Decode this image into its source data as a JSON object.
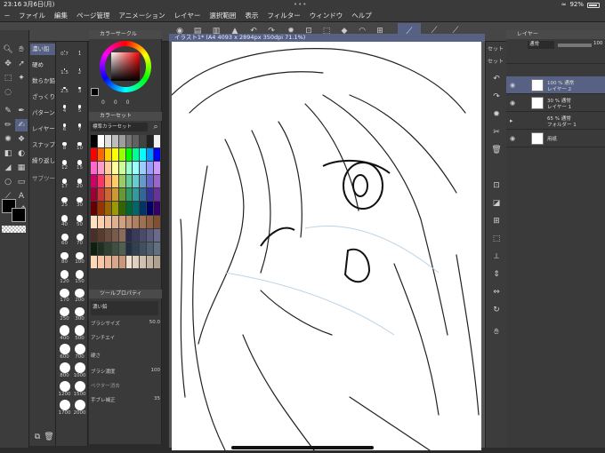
{
  "status": {
    "time": "23:16",
    "date": "3月6日(月)",
    "battery": "92%"
  },
  "menu": {
    "items": [
      "ファイル",
      "編集",
      "ページ管理",
      "アニメーション",
      "レイヤー",
      "選択範囲",
      "表示",
      "フィルター",
      "ウィンドウ",
      "ヘルプ"
    ]
  },
  "document": {
    "tab_title": "イラスト1* (A4 4093 x 2894px 350dpi 71.1%)"
  },
  "subtools": {
    "items": [
      "濃い鉛",
      "硬め",
      "数らか鉛",
      "ざっくり",
      "パターン",
      "レイヤー",
      "スナップ",
      "繰り返し",
      "サブツール"
    ]
  },
  "brush_sizes": [
    "0.7",
    "1",
    "1.5",
    "2",
    "2.5",
    "3",
    "4",
    "5",
    "6",
    "7",
    "8",
    "10",
    "12",
    "15",
    "17",
    "20",
    "25",
    "30",
    "40",
    "50",
    "60",
    "70",
    "80",
    "100",
    "120",
    "150",
    "170",
    "200",
    "250",
    "300",
    "400",
    "500",
    "600",
    "700",
    "800",
    "1000",
    "1200",
    "1500",
    "1700",
    "2000"
  ],
  "color_panel": {
    "title": "カラーサークル",
    "hsv_h": "0",
    "hsv_s": "0",
    "hsv_v": "0"
  },
  "color_set": {
    "title": "カラーセット",
    "set_name": "標準カラーセット",
    "swatches": [
      "#000000",
      "#ffffff",
      "#e0e0e0",
      "#bdbdbd",
      "#9e9e9e",
      "#757575",
      "#616161",
      "#424242",
      "#212121",
      "#f2f2f2",
      "#ff0000",
      "#ff6600",
      "#ffcc00",
      "#ffff00",
      "#99ff00",
      "#00ff00",
      "#00ff99",
      "#00ffff",
      "#0099ff",
      "#0000ff",
      "#ff66cc",
      "#ff99cc",
      "#ffcc99",
      "#ffff99",
      "#ccff99",
      "#99ffcc",
      "#99ffff",
      "#99ccff",
      "#9999ff",
      "#cc99ff",
      "#cc0066",
      "#ff3366",
      "#ff9966",
      "#ffcc66",
      "#99cc66",
      "#66cc99",
      "#66cccc",
      "#6699cc",
      "#6666cc",
      "#9966cc",
      "#990033",
      "#cc3333",
      "#cc6633",
      "#cc9933",
      "#669933",
      "#339966",
      "#339999",
      "#336699",
      "#333399",
      "#663399",
      "#660000",
      "#993300",
      "#996600",
      "#999900",
      "#336600",
      "#006633",
      "#006666",
      "#003366",
      "#000066",
      "#330066",
      "#ffe0c0",
      "#ffd0b0",
      "#f0c0a0",
      "#e0b090",
      "#d0a080",
      "#c09070",
      "#b08060",
      "#a07050",
      "#906040",
      "#805030",
      "#4a2e2a",
      "#5a3a2a",
      "#6a4a3a",
      "#7a5a4a",
      "#8a6a5a",
      "#2a2a4a",
      "#3a3a5a",
      "#4a4a6a",
      "#5a5a7a",
      "#6a6a8a",
      "#102010",
      "#203020",
      "#304030",
      "#405040",
      "#506050",
      "#203040",
      "#304050",
      "#405060",
      "#506070",
      "#607080",
      "#ffd8b8",
      "#f8c8a8",
      "#e8b898",
      "#d8a888",
      "#c89878",
      "#f0e0d0",
      "#e0d0c0",
      "#d0c0b0",
      "#c0b0a0",
      "#b0a090"
    ]
  },
  "tool_property": {
    "title": "ツールプロパティ",
    "brush_name": "濃い鉛",
    "brush_size_label": "ブラシサイズ",
    "brush_size": "50.0",
    "antialias_label": "アンチエイ",
    "hardness_label": "硬さ",
    "density_label": "ブラシ濃度",
    "density": "100",
    "pressure_label": "ベクター消去",
    "correction_label": "手ブレ補正",
    "correction": "35"
  },
  "layer_panel": {
    "title": "レイヤー",
    "blend_mode": "通常",
    "opacity": "100",
    "layers": [
      {
        "opacity": "100 %",
        "mode": "通常",
        "name": "レイヤー 2",
        "selected": true
      },
      {
        "opacity": "30 %",
        "mode": "通常",
        "name": "レイヤー 1",
        "selected": false
      },
      {
        "opacity": "65 %",
        "mode": "通常",
        "name": "フォルダー 1",
        "selected": false
      },
      {
        "opacity": "",
        "mode": "",
        "name": "用紙",
        "selected": false
      }
    ]
  },
  "reset_labels": [
    "セット",
    "セット"
  ],
  "icons": [
    "pen-icon",
    "eraser-icon",
    "bucket-icon",
    "move-icon",
    "zoom-icon",
    "eyedropper-icon",
    "undo-icon",
    "redo-icon"
  ]
}
